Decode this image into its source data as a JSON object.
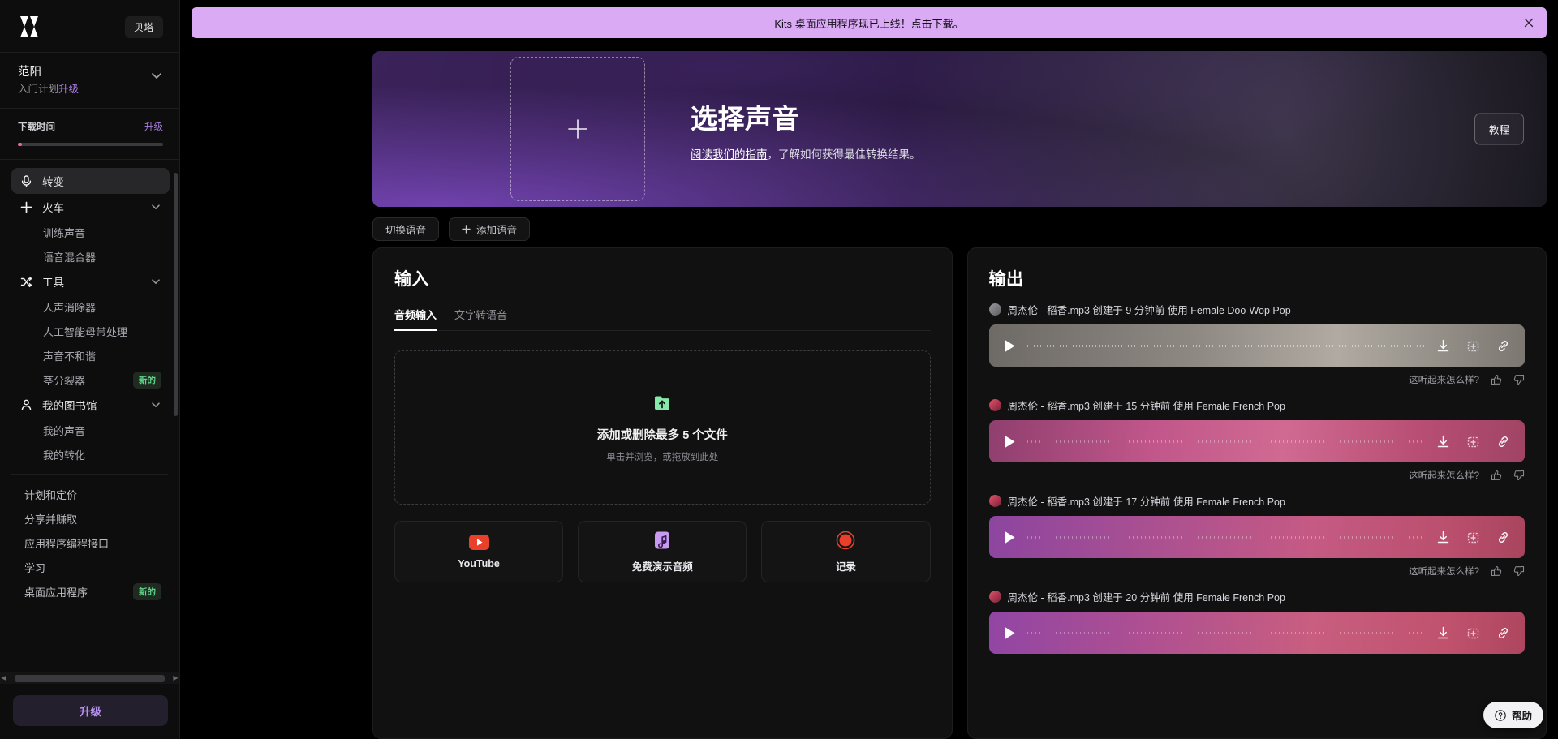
{
  "sidebar": {
    "logo_icon": "kits-logo-icon",
    "beta_label": "贝塔",
    "account": {
      "name": "范阳",
      "plan": "入门计划",
      "plan_upgrade": "升级"
    },
    "usage": {
      "label": "下载时间",
      "upgrade_label": "升级",
      "progress_percent": 3
    },
    "nav": [
      {
        "label": "转变",
        "icon": "microphone-icon",
        "active": true,
        "type": "item"
      },
      {
        "label": "火车",
        "icon": "plus-icon",
        "expandable": true,
        "type": "item"
      },
      {
        "label": "训练声音",
        "type": "sub"
      },
      {
        "label": "语音混合器",
        "type": "sub"
      },
      {
        "label": "工具",
        "icon": "shuffle-icon",
        "expandable": true,
        "type": "item"
      },
      {
        "label": "人声消除器",
        "type": "sub"
      },
      {
        "label": "人工智能母带处理",
        "type": "sub"
      },
      {
        "label": "声音不和谐",
        "type": "sub"
      },
      {
        "label": "茎分裂器",
        "type": "sub",
        "badge": "新的"
      },
      {
        "label": "我的图书馆",
        "icon": "person-icon",
        "expandable": true,
        "type": "item"
      },
      {
        "label": "我的声音",
        "type": "sub"
      },
      {
        "label": "我的转化",
        "type": "sub"
      }
    ],
    "links": [
      {
        "label": "计划和定价"
      },
      {
        "label": "分享并赚取"
      },
      {
        "label": "应用程序编程接口"
      },
      {
        "label": "学习"
      },
      {
        "label": "桌面应用程序",
        "badge": "新的"
      }
    ],
    "upgrade_button": "升级"
  },
  "announcement": {
    "text": "Kits 桌面应用程序现已上线！点击下载。",
    "background": "#dbaaf5",
    "close_icon": "close-icon"
  },
  "hero": {
    "dropzone_icon": "plus-icon",
    "title": "选择声音",
    "sub_link": "阅读我们的指南",
    "sub_rest": "，了解如何获得最佳转换结果。",
    "tutorial_button": "教程"
  },
  "voice_tabs": [
    {
      "label": "切换语音",
      "icon": null
    },
    {
      "label": "添加语音",
      "icon": "plus-icon"
    }
  ],
  "input_panel": {
    "title": "输入",
    "tabs": [
      {
        "label": "音频输入",
        "active": true
      },
      {
        "label": "文字转语音",
        "active": false
      }
    ],
    "dropzone": {
      "icon": "folder-upload-icon",
      "title": "添加或删除最多 5 个文件",
      "subtitle": "单击并浏览，或拖放到此处"
    },
    "sources": [
      {
        "label": "YouTube",
        "icon": "youtube-icon",
        "color": "#e8402a"
      },
      {
        "label": "免费演示音频",
        "icon": "music-note-icon",
        "color": "#c89af0"
      },
      {
        "label": "记录",
        "icon": "record-icon",
        "color": "#e8402a"
      }
    ]
  },
  "output_panel": {
    "title": "输出",
    "feedback_label": "这听起来怎么样?",
    "actions": [
      "download-icon",
      "save-icon",
      "link-icon"
    ],
    "tracks": [
      {
        "meta": "周杰伦 - 稻香.mp3 创建于 9 分钟前 使用 Female Doo-Wop Pop",
        "avatar_color": "#8c8c90",
        "waveform_color_a": "#6e6a66",
        "waveform_color_b": "#a6a09a"
      },
      {
        "meta": "周杰伦 - 稻香.mp3 创建于 15 分钟前 使用 Female French Pop",
        "avatar_color": "#c03a5a",
        "waveform_color_a": "#a83f6a",
        "waveform_color_b": "#c06a90"
      },
      {
        "meta": "周杰伦 - 稻香.mp3 创建于 17 分钟前 使用 Female French Pop",
        "avatar_color": "#c03a5a",
        "waveform_color_a": "#9b4a86",
        "waveform_color_b": "#c25a7a"
      },
      {
        "meta": "周杰伦 - 稻香.mp3 创建于 20 分钟前 使用 Female French Pop",
        "avatar_color": "#c03a5a",
        "waveform_color_a": "#a8498a",
        "waveform_color_b": "#c8607e"
      }
    ]
  },
  "help": {
    "label": "帮助",
    "icon": "question-circle-icon"
  }
}
